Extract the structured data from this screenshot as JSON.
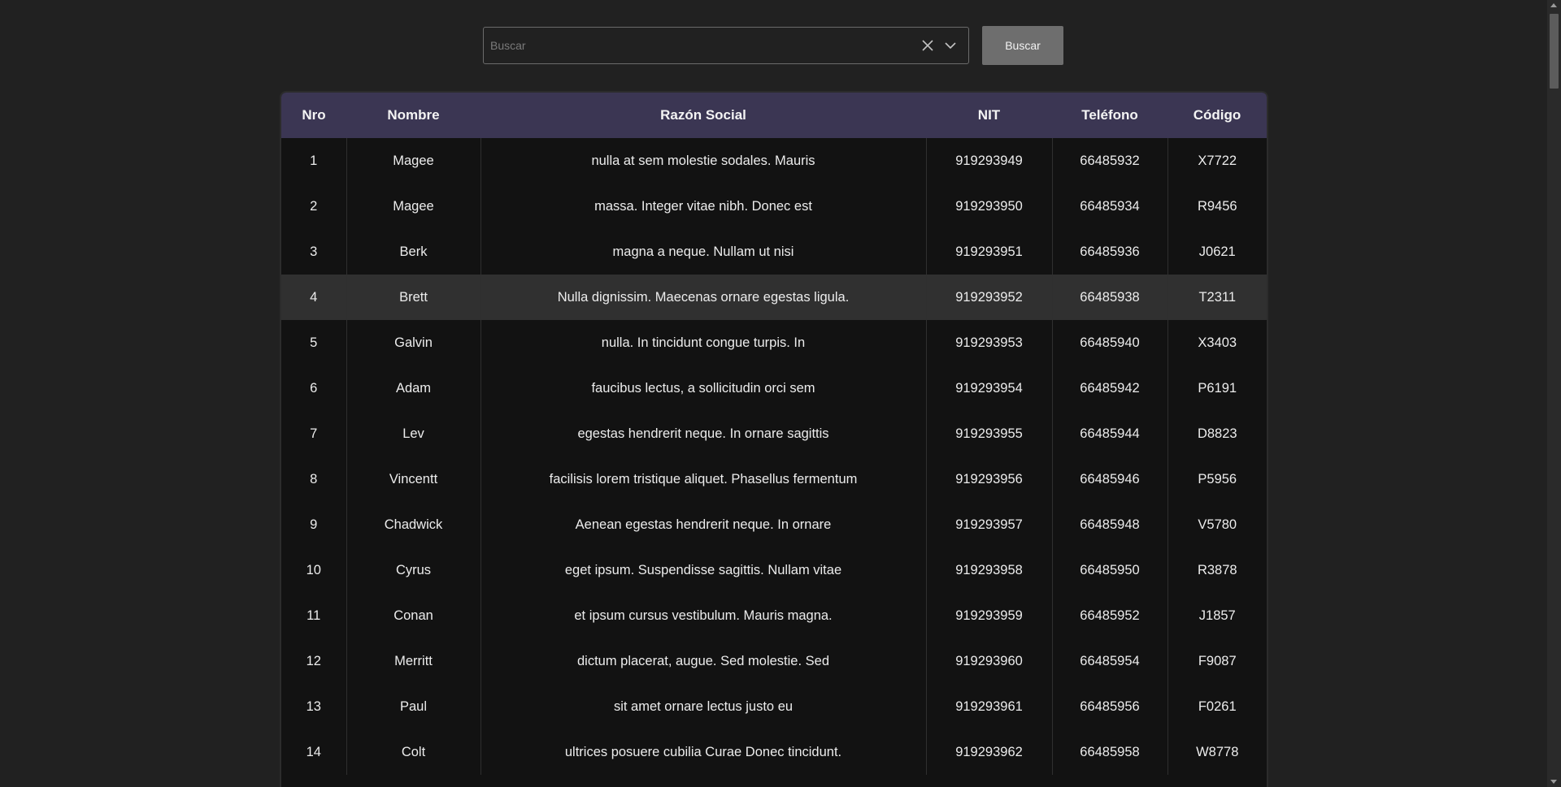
{
  "search": {
    "placeholder": "Buscar",
    "value": "",
    "button_label": "Buscar",
    "clear_icon": "close-icon",
    "dropdown_icon": "chevron-down-icon"
  },
  "table": {
    "columns": [
      "Nro",
      "Nombre",
      "Razón Social",
      "NIT",
      "Teléfono",
      "Código"
    ],
    "highlighted_row": 4,
    "rows": [
      {
        "nro": "1",
        "nombre": "Magee",
        "razon_social": "nulla at sem molestie sodales. Mauris",
        "nit": "919293949",
        "telefono": "66485932",
        "codigo": "X7722"
      },
      {
        "nro": "2",
        "nombre": "Magee",
        "razon_social": "massa. Integer vitae nibh. Donec est",
        "nit": "919293950",
        "telefono": "66485934",
        "codigo": "R9456"
      },
      {
        "nro": "3",
        "nombre": "Berk",
        "razon_social": "magna a neque. Nullam ut nisi",
        "nit": "919293951",
        "telefono": "66485936",
        "codigo": "J0621"
      },
      {
        "nro": "4",
        "nombre": "Brett",
        "razon_social": "Nulla dignissim. Maecenas ornare egestas ligula.",
        "nit": "919293952",
        "telefono": "66485938",
        "codigo": "T2311"
      },
      {
        "nro": "5",
        "nombre": "Galvin",
        "razon_social": "nulla. In tincidunt congue turpis. In",
        "nit": "919293953",
        "telefono": "66485940",
        "codigo": "X3403"
      },
      {
        "nro": "6",
        "nombre": "Adam",
        "razon_social": "faucibus lectus, a sollicitudin orci sem",
        "nit": "919293954",
        "telefono": "66485942",
        "codigo": "P6191"
      },
      {
        "nro": "7",
        "nombre": "Lev",
        "razon_social": "egestas hendrerit neque. In ornare sagittis",
        "nit": "919293955",
        "telefono": "66485944",
        "codigo": "D8823"
      },
      {
        "nro": "8",
        "nombre": "Vincentt",
        "razon_social": "facilisis lorem tristique aliquet. Phasellus fermentum",
        "nit": "919293956",
        "telefono": "66485946",
        "codigo": "P5956"
      },
      {
        "nro": "9",
        "nombre": "Chadwick",
        "razon_social": "Aenean egestas hendrerit neque. In ornare",
        "nit": "919293957",
        "telefono": "66485948",
        "codigo": "V5780"
      },
      {
        "nro": "10",
        "nombre": "Cyrus",
        "razon_social": "eget ipsum. Suspendisse sagittis. Nullam vitae",
        "nit": "919293958",
        "telefono": "66485950",
        "codigo": "R3878"
      },
      {
        "nro": "11",
        "nombre": "Conan",
        "razon_social": "et ipsum cursus vestibulum. Mauris magna.",
        "nit": "919293959",
        "telefono": "66485952",
        "codigo": "J1857"
      },
      {
        "nro": "12",
        "nombre": "Merritt",
        "razon_social": "dictum placerat, augue. Sed molestie. Sed",
        "nit": "919293960",
        "telefono": "66485954",
        "codigo": "F9087"
      },
      {
        "nro": "13",
        "nombre": "Paul",
        "razon_social": "sit amet ornare lectus justo eu",
        "nit": "919293961",
        "telefono": "66485956",
        "codigo": "F0261"
      },
      {
        "nro": "14",
        "nombre": "Colt",
        "razon_social": "ultrices posuere cubilia Curae Donec tincidunt.",
        "nit": "919293962",
        "telefono": "66485958",
        "codigo": "W8778"
      }
    ]
  },
  "colors": {
    "page_background": "#212121",
    "table_background": "#121212",
    "header_background": "#3b3653",
    "highlight_row": "#303030",
    "button_background": "#6e6e6e"
  }
}
